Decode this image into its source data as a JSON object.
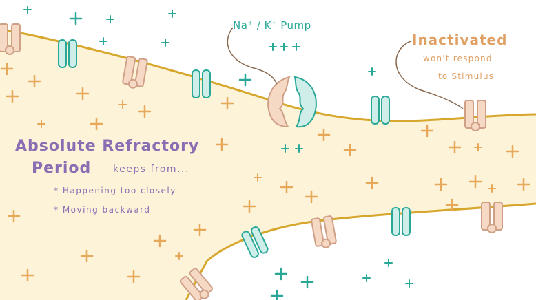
{
  "labels": {
    "title_line1": "Absolute Refractory",
    "title_line2": "Period",
    "keeps_from": "keeps from...",
    "bullet_marker": "*",
    "bullets": [
      "Happening too closely",
      "Moving backward"
    ],
    "pump_na": "Na",
    "pump_sup": "+",
    "pump_sep": "/",
    "pump_k": "K",
    "pump_rest": "Pump",
    "inactivated": "Inactivated",
    "wont_respond": "won't respond",
    "to_stimulus": "to Stimulus"
  },
  "colors": {
    "membrane": "#d6a72c",
    "cytoplasm": "#fcf3d8",
    "purple": "#8b6db3",
    "teal": "#2aa897",
    "teal_fill": "#cfeee9",
    "orange": "#e8a85a",
    "tan_fill": "#f6d9c4",
    "tan_stroke": "#cf9f86"
  }
}
